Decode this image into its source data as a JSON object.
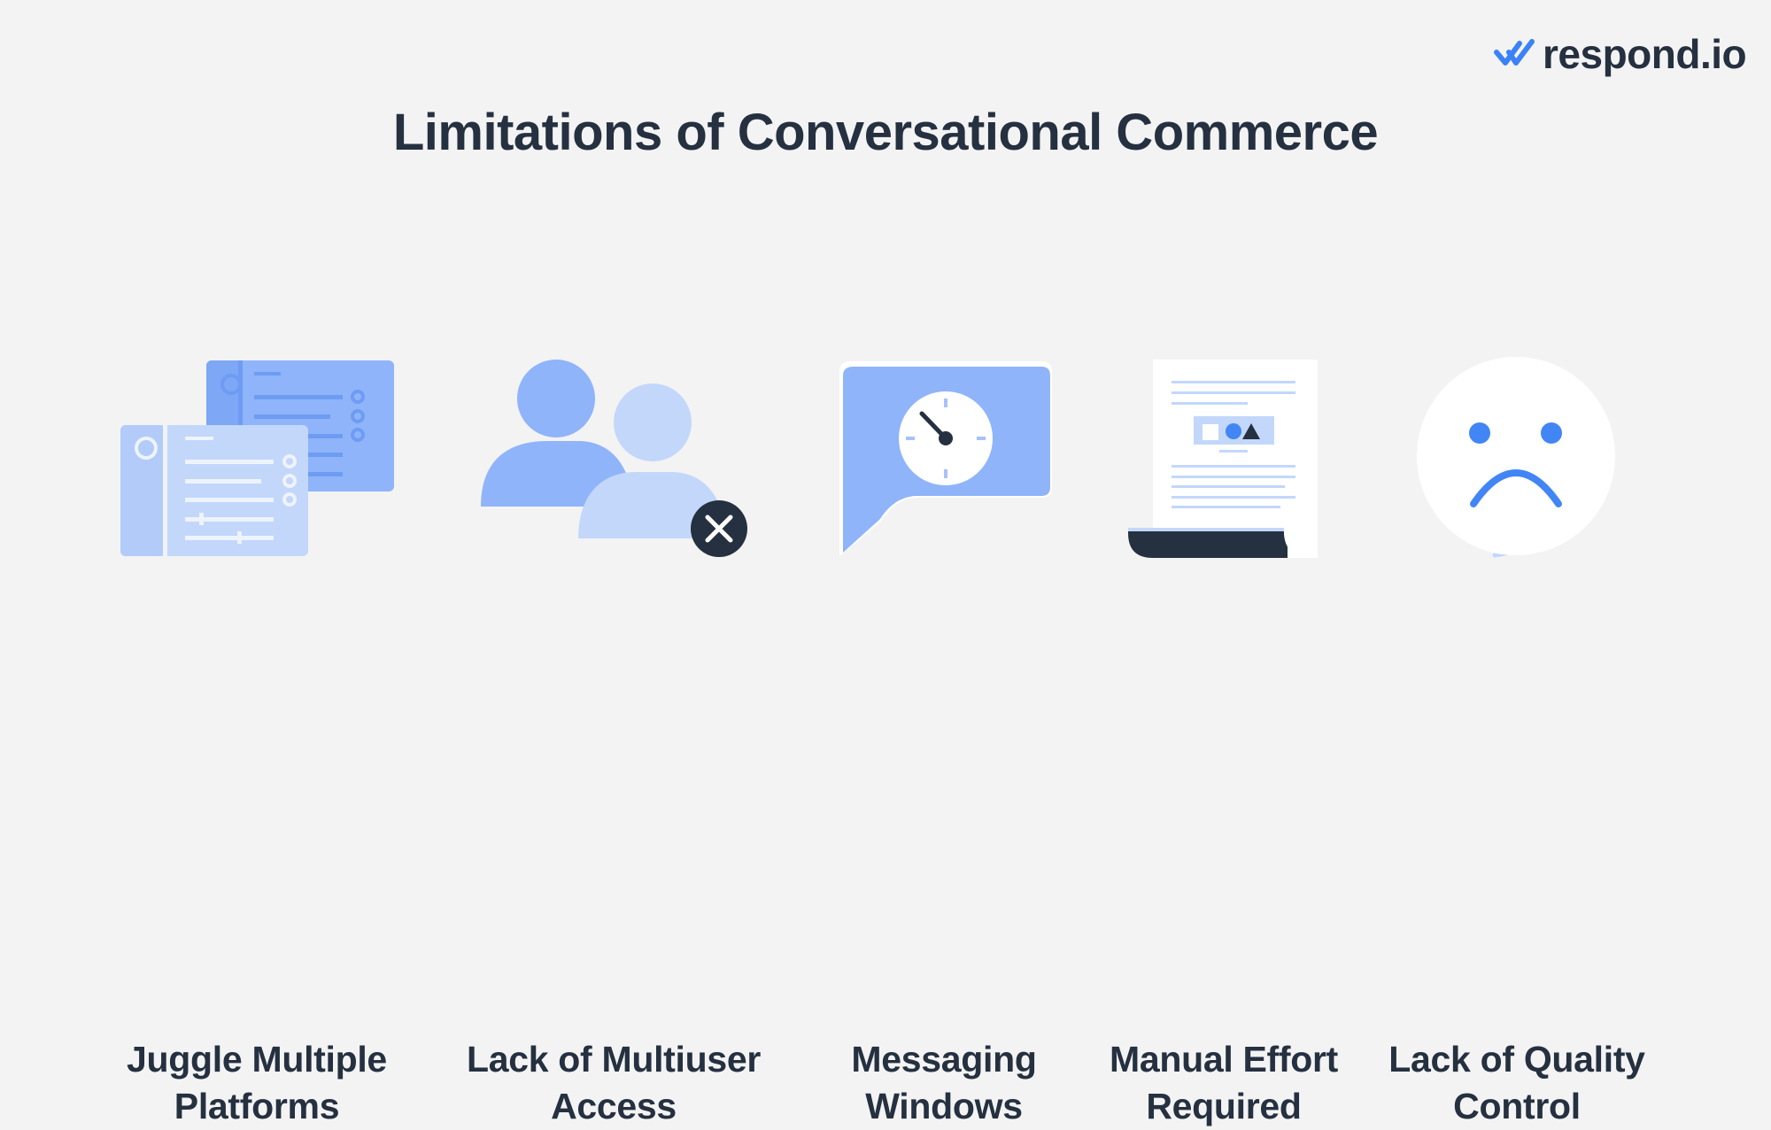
{
  "brand": {
    "name": "respond.io",
    "icon": "double-check-icon",
    "accent_color": "#3b82f6"
  },
  "title": "Limitations of Conversational Commerce",
  "colors": {
    "background": "#f3f3f3",
    "text": "#253040",
    "blue_dark": "#8fb4fa",
    "blue_light": "#c3d7fb",
    "blue_accent": "#4286f5",
    "navy": "#253040"
  },
  "items": [
    {
      "icon": "multiple-windows-icon",
      "label_lines": [
        "Juggle Multiple",
        "Platforms"
      ]
    },
    {
      "icon": "users-blocked-icon",
      "label_lines": [
        "Lack of Multiuser",
        "Access"
      ]
    },
    {
      "icon": "chat-clock-icon",
      "label_lines": [
        "Messaging",
        "Windows"
      ]
    },
    {
      "icon": "document-scroll-icon",
      "label_lines": [
        "Manual Effort",
        "Required"
      ]
    },
    {
      "icon": "sad-face-icon",
      "label_lines": [
        "Lack of Quality",
        "Control"
      ]
    }
  ]
}
